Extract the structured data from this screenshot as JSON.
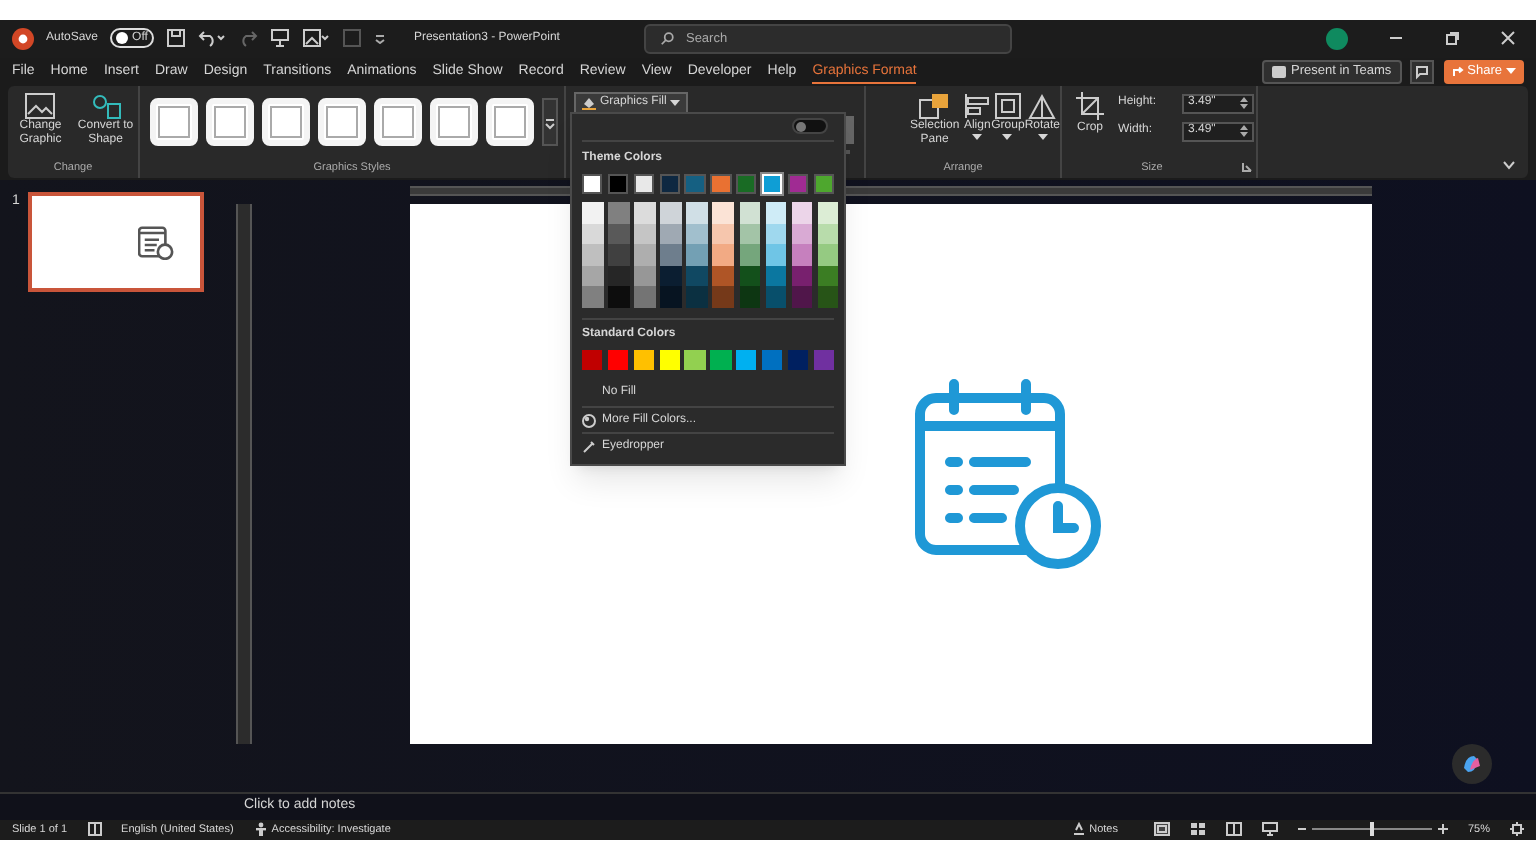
{
  "title_bar": {
    "autosave_label": "AutoSave",
    "autosave_toggle": {
      "label": "Off",
      "on": false
    },
    "document_title": "Presentation3 - PowerPoint",
    "search": {
      "placeholder": "Search"
    }
  },
  "menu_tabs": [
    {
      "label": "File",
      "selected": false
    },
    {
      "label": "Home",
      "selected": false
    },
    {
      "label": "Insert",
      "selected": false
    },
    {
      "label": "Draw",
      "selected": false
    },
    {
      "label": "Design",
      "selected": false
    },
    {
      "label": "Transitions",
      "selected": false
    },
    {
      "label": "Animations",
      "selected": false
    },
    {
      "label": "Slide Show",
      "selected": false
    },
    {
      "label": "Record",
      "selected": false
    },
    {
      "label": "Review",
      "selected": false
    },
    {
      "label": "View",
      "selected": false
    },
    {
      "label": "Developer",
      "selected": false
    },
    {
      "label": "Help",
      "selected": false
    },
    {
      "label": "Graphics Format",
      "selected": true
    }
  ],
  "menu_buttons": {
    "present": "Present in Teams",
    "share": "Share"
  },
  "ribbon": {
    "change_group": {
      "label": "Change",
      "buttons": [
        "Change Graphic",
        "Convert to Shape"
      ]
    },
    "styles_group": {
      "label": "Graphics Styles"
    },
    "fill_button": "Graphics Fill",
    "arrange_group": {
      "label": "Arrange",
      "buttons": [
        "Selection Pane",
        "Align",
        "Group",
        "Rotate"
      ]
    },
    "size_group": {
      "label": "Size",
      "crop": "Crop",
      "height_label": "Height:",
      "height_value": "3.49\"",
      "width_label": "Width:",
      "width_value": "3.49\""
    }
  },
  "fill_menu": {
    "auto_toggle": {
      "on": false
    },
    "theme_header": "Theme Colors",
    "theme_colors": [
      {
        "color": "#ffffff",
        "selected": false
      },
      {
        "color": "#000000",
        "selected": false
      },
      {
        "color": "#e8e8e8",
        "selected": false
      },
      {
        "color": "#0e2841",
        "selected": false
      },
      {
        "color": "#156082",
        "selected": false
      },
      {
        "color": "#e97132",
        "selected": false
      },
      {
        "color": "#196b24",
        "selected": false
      },
      {
        "color": "#0f9ed5",
        "selected": true
      },
      {
        "color": "#a02b93",
        "selected": false
      },
      {
        "color": "#4ea72e",
        "selected": false
      }
    ],
    "standard_header": "Standard Colors",
    "standard_colors": [
      {
        "color": "#c00000"
      },
      {
        "color": "#ff0000"
      },
      {
        "color": "#ffc000"
      },
      {
        "color": "#ffff00"
      },
      {
        "color": "#92d050"
      },
      {
        "color": "#00b050"
      },
      {
        "color": "#00b0f0"
      },
      {
        "color": "#0070c0"
      },
      {
        "color": "#002060"
      },
      {
        "color": "#7030a0"
      }
    ],
    "items": [
      {
        "kind": "plain",
        "label": "No Fill"
      },
      {
        "kind": "palette",
        "label": "More Fill Colors..."
      },
      {
        "kind": "eyedropper",
        "label": "Eyedropper"
      }
    ]
  },
  "thumbnails": [
    {
      "number": "1",
      "selected": true
    }
  ],
  "notes": {
    "placeholder": "Click to add notes"
  },
  "status_bar": {
    "slide": "Slide 1 of 1",
    "language": "English (United States)",
    "accessibility": "Accessibility: Investigate",
    "notes": "Notes",
    "zoom_slider": {
      "level": 0.5
    },
    "zoom": "75%"
  }
}
